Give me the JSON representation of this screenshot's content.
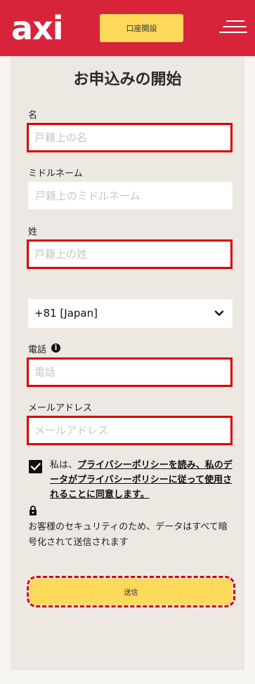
{
  "header": {
    "logo_text": "axi",
    "open_account_label": "口座開設",
    "brand_color": "#d8243a",
    "accent_color": "#ffd95a",
    "menu_icon": "hamburger-menu-icon"
  },
  "form": {
    "title": "お申込みの開始",
    "first_name": {
      "label": "名",
      "placeholder": "戸籍上の名"
    },
    "middle_name": {
      "label": "ミドルネーム",
      "placeholder": "戸籍上のミドルネーム"
    },
    "last_name": {
      "label": "姓",
      "placeholder": "戸籍上の姓"
    },
    "phone_country": {
      "selected": "+81 [Japan]"
    },
    "phone": {
      "label": "電話",
      "placeholder": "電話",
      "info_icon": "info-icon"
    },
    "email": {
      "label": "メールアドレス",
      "placeholder": "メールアドレス"
    },
    "consent": {
      "checked": true,
      "prefix": "私は、",
      "link_text": "プライバシーポリシーを読み、私のデータがプライバシーポリシーに従って使用されることに同意します。"
    },
    "security": {
      "icon": "lock-icon",
      "note": "お客様のセキュリティのため、データはすべて暗号化されて送信されます"
    },
    "submit_label": "送信",
    "error_color": "#d80000"
  }
}
